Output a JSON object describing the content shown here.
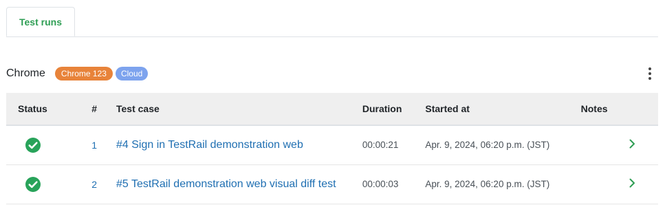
{
  "tabs": [
    {
      "label": "Test runs"
    }
  ],
  "browser": {
    "name": "Chrome",
    "badges": [
      "Chrome 123",
      "Cloud"
    ]
  },
  "table": {
    "headers": {
      "status": "Status",
      "number": "#",
      "test_case": "Test case",
      "duration": "Duration",
      "started_at": "Started at",
      "notes": "Notes"
    },
    "rows": [
      {
        "status": "passed",
        "number": "1",
        "test_case": "#4 Sign in TestRail demonstration web",
        "duration": "00:00:21",
        "started_at": "Apr. 9, 2024, 06:20 p.m. (JST)",
        "notes": ""
      },
      {
        "status": "passed",
        "number": "2",
        "test_case": "#5 TestRail demonstration web visual diff test",
        "duration": "00:00:03",
        "started_at": "Apr. 9, 2024, 06:20 p.m. (JST)",
        "notes": ""
      }
    ]
  },
  "colors": {
    "accent_green": "#2f9e54",
    "pass_green": "#28a35a",
    "link_blue": "#1f6fb2",
    "badge_orange": "#e8833a",
    "badge_blue": "#7da3ee"
  },
  "icons": {
    "status": "check-circle-icon",
    "row_action": "chevron-right-icon",
    "menu": "more-vertical-icon"
  }
}
